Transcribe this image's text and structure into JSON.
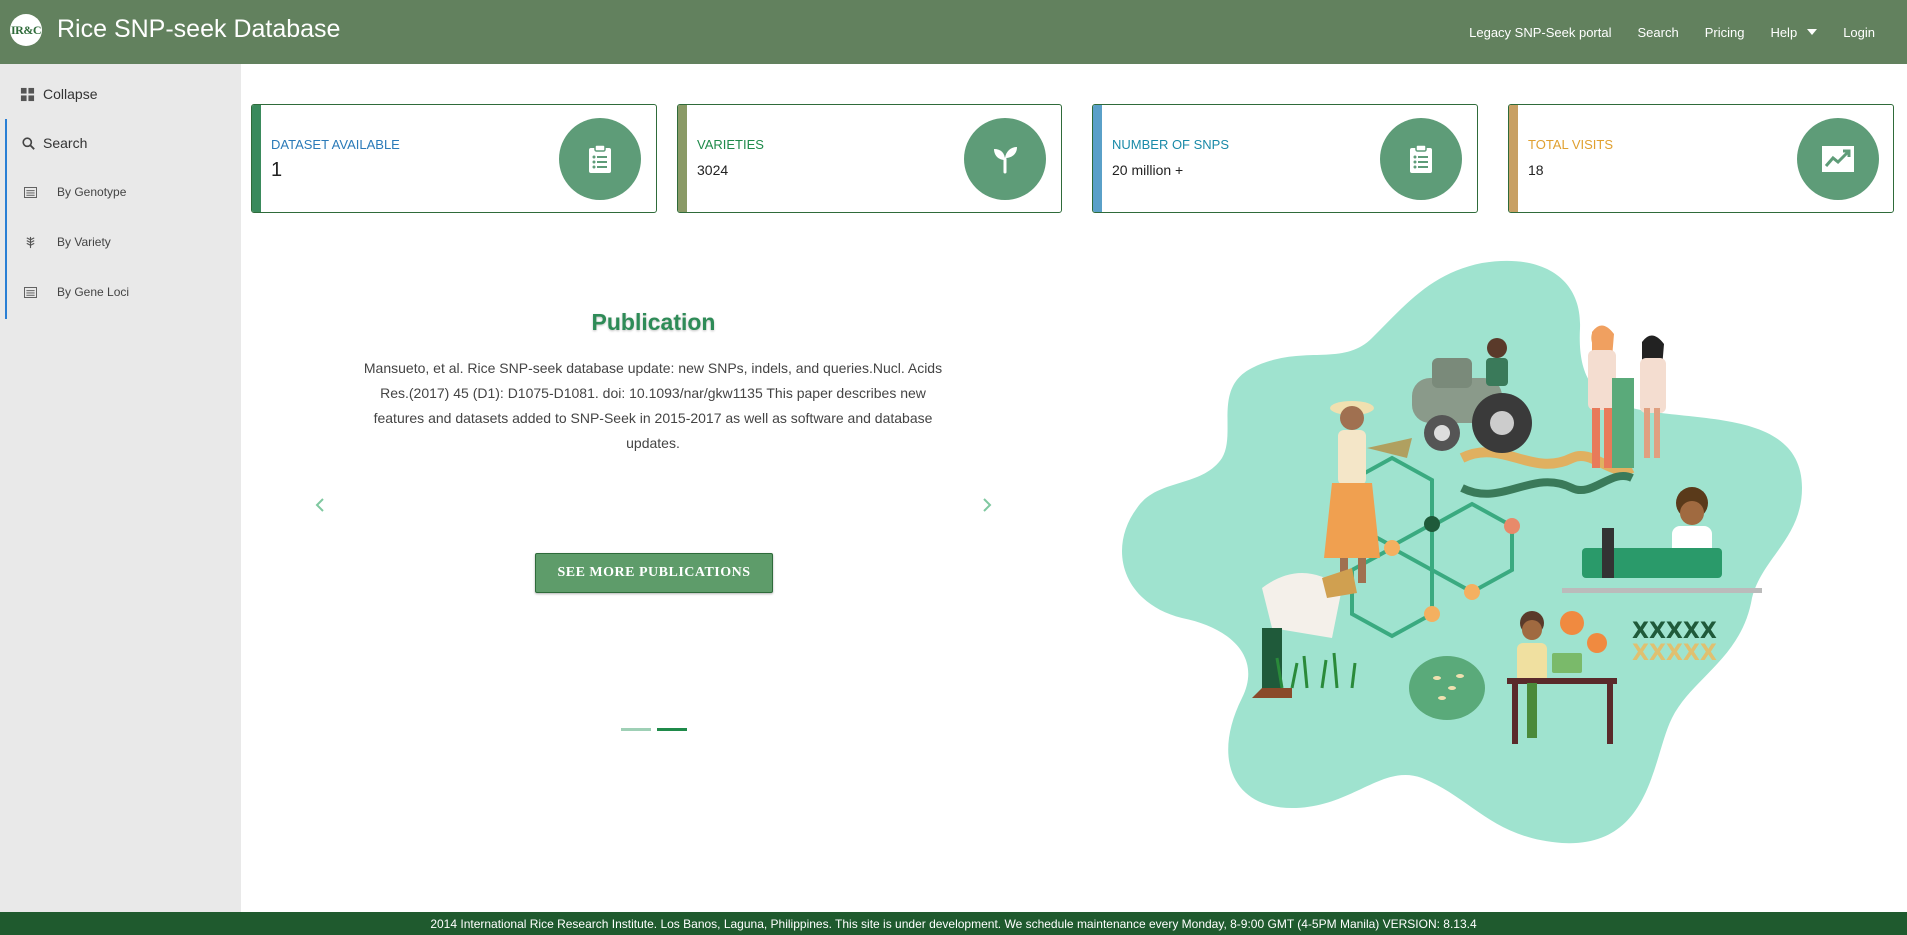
{
  "header": {
    "logo_text": "IR&C",
    "title": "Rice SNP-seek Database",
    "nav": {
      "legacy": "Legacy SNP-Seek portal",
      "search": "Search",
      "pricing": "Pricing",
      "help": "Help",
      "login": "Login"
    },
    "bg_color": "#62815e"
  },
  "sidebar": {
    "collapse_label": "Collapse",
    "search_label": "Search",
    "items": [
      {
        "label": "By Genotype",
        "icon": "list-icon"
      },
      {
        "label": "By Variety",
        "icon": "rice-plant-icon"
      },
      {
        "label": "By Gene Loci",
        "icon": "list-icon"
      }
    ]
  },
  "stats": [
    {
      "title": "DATASET AVAILABLE",
      "value": "1",
      "title_color": "#2a7ab8",
      "stripe_color": "#3a8a5c",
      "icon": "clipboard-list-icon"
    },
    {
      "title": "VARIETIES",
      "value": "3024",
      "title_color": "#1f8a4a",
      "stripe_color": "#8a9a66",
      "icon": "seedling-icon"
    },
    {
      "title": "NUMBER OF SNPS",
      "value": "20 million +",
      "title_color": "#1a8aa8",
      "stripe_color": "#5aa0c8",
      "icon": "clipboard-list-icon"
    },
    {
      "title": "TOTAL VISITS",
      "value": "18",
      "title_color": "#e0a030",
      "stripe_color": "#c8a064",
      "icon": "chart-line-icon"
    }
  ],
  "publication": {
    "heading": "Publication",
    "text": "Mansueto, et al. Rice SNP-seek database update: new SNPs, indels, and queries.Nucl. Acids Res.(2017) 45 (D1): D1075-D1081. doi: 10.1093/nar/gkw1135 This paper describes new features and datasets added to SNP-Seek in 2015-2017 as well as software and database updates.",
    "button_label": "SEE MORE PUBLICATIONS",
    "active_slide": 2,
    "slide_count": 2
  },
  "footer": {
    "text": "2014 International Rice Research Institute. Los Banos, Laguna, Philippines. This site is under development. We schedule maintenance every Monday, 8-9:00 GMT (4-5PM Manila) VERSION: 8.13.4"
  }
}
